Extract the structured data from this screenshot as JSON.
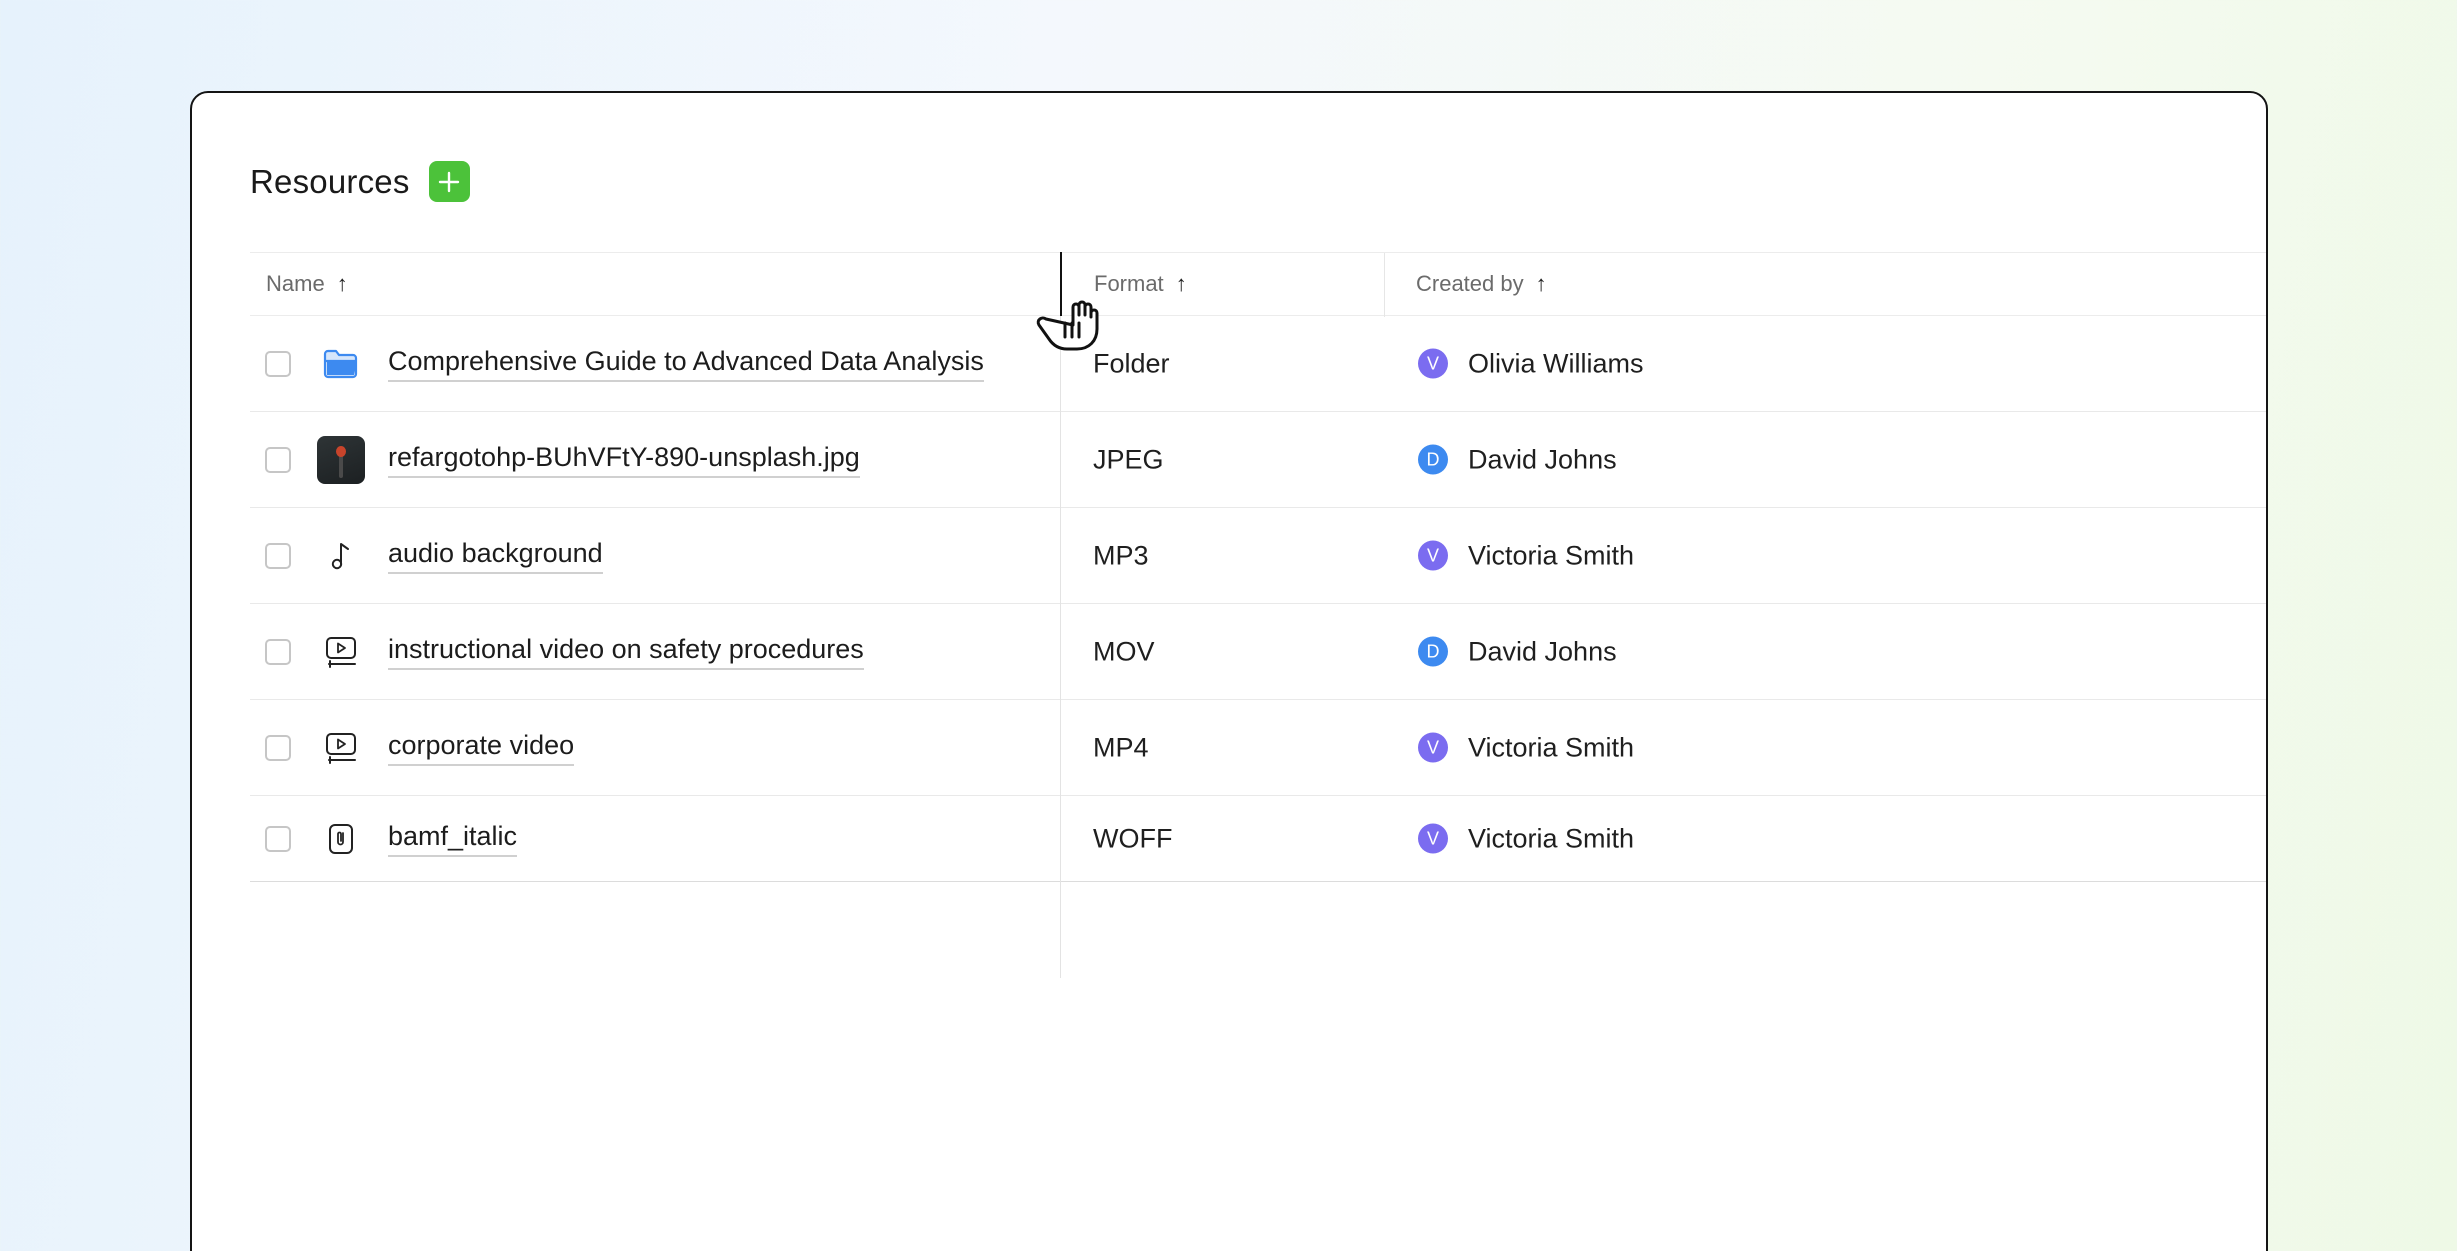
{
  "header": {
    "title": "Resources",
    "add_icon": "plus-icon"
  },
  "columns": {
    "name": {
      "label": "Name",
      "sort": "↑"
    },
    "format": {
      "label": "Format",
      "sort": "↑"
    },
    "created_by": {
      "label": "Created by",
      "sort": "↑"
    }
  },
  "rows": [
    {
      "name": "Comprehensive Guide to Advanced Data Analysis",
      "icon": "folder-icon",
      "format": "Folder",
      "creator": "Olivia Williams",
      "avatar_letter": "V",
      "avatar_color": "#7b6cf0"
    },
    {
      "name": "refargotohp-BUhVFtY-890-unsplash.jpg",
      "icon": "image-thumbnail",
      "format": "JPEG",
      "creator": "David Johns",
      "avatar_letter": "D",
      "avatar_color": "#3d8af0"
    },
    {
      "name": "audio background",
      "icon": "music-note-icon",
      "format": "MP3",
      "creator": "Victoria Smith",
      "avatar_letter": "V",
      "avatar_color": "#7b6cf0"
    },
    {
      "name": "instructional video on safety procedures",
      "icon": "video-icon",
      "format": "MOV",
      "creator": "David Johns",
      "avatar_letter": "D",
      "avatar_color": "#3d8af0"
    },
    {
      "name": "corporate video",
      "icon": "video-icon",
      "format": "MP4",
      "creator": "Victoria Smith",
      "avatar_letter": "V",
      "avatar_color": "#7b6cf0"
    },
    {
      "name": "bamf_italic",
      "icon": "attachment-file-icon",
      "format": "WOFF",
      "creator": "Victoria Smith",
      "avatar_letter": "V",
      "avatar_color": "#7b6cf0"
    }
  ],
  "colors": {
    "accent_green": "#4cc23a",
    "folder_blue": "#3d8af0",
    "avatar_purple": "#7b6cf0",
    "avatar_blue": "#3d8af0"
  },
  "cursor": "grab-resize-cursor-icon"
}
